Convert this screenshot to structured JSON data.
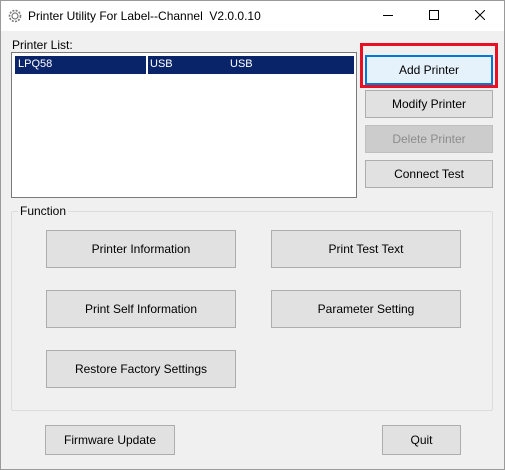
{
  "window": {
    "title": "Printer Utility For Label--Channel  V2.0.0.10",
    "controls": {
      "minimize": "minimize-icon",
      "maximize": "maximize-icon",
      "close": "close-icon"
    }
  },
  "printer_list": {
    "label": "Printer List:",
    "rows": [
      {
        "name": "LPQ58",
        "port": "USB",
        "type": "USB",
        "selected": true
      }
    ]
  },
  "side_buttons": {
    "add_printer": "Add Printer",
    "modify_printer": "Modify Printer",
    "delete_printer": "Delete Printer",
    "connect_test": "Connect Test"
  },
  "function_group": {
    "title": "Function",
    "printer_information": "Printer Information",
    "print_test_text": "Print Test Text",
    "print_self_information": "Print Self Information",
    "parameter_setting": "Parameter Setting",
    "restore_factory_settings": "Restore Factory Settings"
  },
  "footer": {
    "firmware_update": "Firmware Update",
    "quit": "Quit"
  },
  "colors": {
    "selection": "#0a246a",
    "highlight": "#e81123",
    "focus": "#0078d7"
  }
}
